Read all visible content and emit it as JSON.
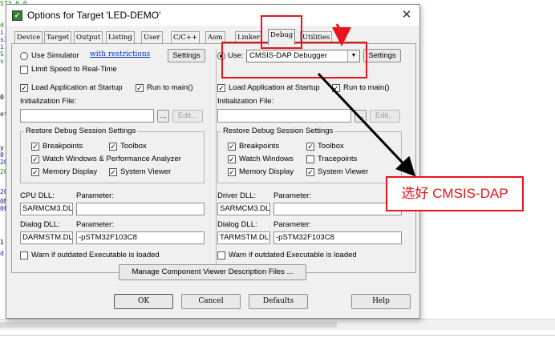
{
  "editor_fragments": [
    "ST3.0.0",
    "d.",
    "i.",
    "s3",
    "i.",
    "S",
    "s",
    "0",
    "of",
    "",
    "",
    "y",
    "0",
    "20",
    "2C",
    "",
    "20",
    "0N",
    "0F",
    "",
    "",
    "1",
    "d"
  ],
  "dialog": {
    "title": "Options for Target 'LED-DEMO'",
    "title_icon": "uvision-icon",
    "close_glyph": "✕"
  },
  "tabs": [
    "Device",
    "Target",
    "Output",
    "Listing",
    "User",
    "C/C++",
    "Asm",
    "Linker",
    "Debug",
    "Utilities"
  ],
  "active_tab": "Debug",
  "left": {
    "use_simulator": "Use Simulator",
    "restrictions_link": "with restrictions",
    "settings": "Settings",
    "limit_speed": "Limit Speed to Real-Time",
    "load_app": "Load Application at Startup",
    "run_to_main": "Run to main()",
    "init_file": "Initialization File:",
    "browse": "...",
    "edit": "Edit...",
    "restore_title": "Restore Debug Session Settings",
    "breakpoints": "Breakpoints",
    "toolbox": "Toolbox",
    "watch": "Watch Windows & Performance Analyzer",
    "memory": "Memory Display",
    "system_viewer": "System Viewer",
    "dll_label": "CPU DLL:",
    "param_label": "Parameter:",
    "dll_value": "SARMCM3.DLL",
    "dll_param": "",
    "dialog_dll_label": "Dialog DLL:",
    "dialog_param_label": "Parameter:",
    "dialog_dll_value": "DARMSTM.DLL",
    "dialog_param_value": "-pSTM32F103C8",
    "warn": "Warn if outdated Executable is loaded"
  },
  "right": {
    "use": "Use:",
    "debugger": "CMSIS-DAP Debugger",
    "settings": "Settings",
    "load_app": "Load Application at Startup",
    "run_to_main": "Run to main()",
    "init_file": "Initialization File:",
    "browse": "...",
    "edit": "Edit...",
    "restore_title": "Restore Debug Session Settings",
    "breakpoints": "Breakpoints",
    "toolbox": "Toolbox",
    "watch": "Watch Windows",
    "tracepoints": "Tracepoints",
    "memory": "Memory Display",
    "system_viewer": "System Viewer",
    "dll_label": "Driver DLL:",
    "param_label": "Parameter:",
    "dll_value": "SARMCM3.DLL",
    "dll_param": "",
    "dialog_dll_label": "Dialog DLL:",
    "dialog_param_label": "Parameter:",
    "dialog_dll_value": "TARMSTM.DLL",
    "dialog_param_value": "-pSTM32F103C8",
    "warn": "Warn if outdated Executable is loaded"
  },
  "manage_button": "Manage Component Viewer Description Files ...",
  "footer": {
    "ok": "OK",
    "cancel": "Cancel",
    "defaults": "Defaults",
    "help": "Help"
  },
  "annotation": {
    "label": "选好 CMSIS-DAP",
    "color": "#e8141c"
  },
  "checked": "✓"
}
